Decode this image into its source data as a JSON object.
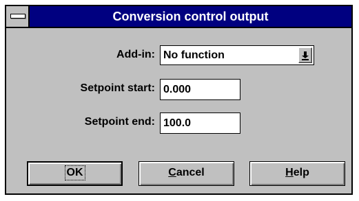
{
  "window": {
    "title": "Conversion control output"
  },
  "form": {
    "addin": {
      "label": "Add-in:",
      "value": "No function"
    },
    "setpoint_start": {
      "label": "Setpoint start:",
      "value": "0.000"
    },
    "setpoint_end": {
      "label": "Setpoint end:",
      "value": "100.0"
    }
  },
  "buttons": {
    "ok": {
      "label": "OK"
    },
    "cancel": {
      "mnemonic": "C",
      "rest": "ancel"
    },
    "help": {
      "mnemonic": "H",
      "rest": "elp"
    }
  },
  "icons": {
    "system_menu": "system-menu-icon",
    "dropdown": "dropdown-arrow-icon"
  },
  "colors": {
    "titlebar": "#000080",
    "dialog_face": "#c0c0c0"
  }
}
